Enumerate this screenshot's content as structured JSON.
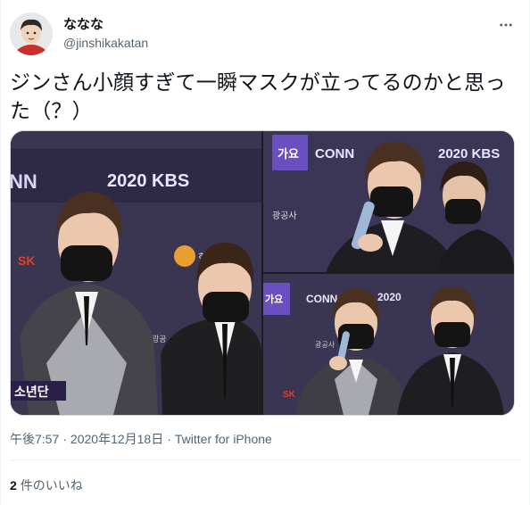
{
  "user": {
    "display_name": "ななな",
    "handle": "@jinshikakatan",
    "avatar_icon": "user-avatar"
  },
  "tweet": {
    "text": "ジンさん小顔すぎて一瞬マスクが立ってるのかと思った（？）"
  },
  "media": {
    "photos": [
      {
        "signs": [
          "2020 KBS",
          "SK",
          "한국",
          "광공",
          "소년단",
          "NN"
        ]
      },
      {
        "signs": [
          "CONN",
          "2020 KBS",
          "가요",
          "광공사"
        ]
      },
      {
        "signs": [
          "CONN",
          "2020",
          "가요",
          "광공사",
          "SK"
        ]
      }
    ]
  },
  "meta": {
    "time": "午後7:57",
    "separator": "·",
    "date": "2020年12月18日",
    "source": "Twitter for iPhone"
  },
  "stats": {
    "likes_count": "2",
    "likes_label": "件のいいね"
  },
  "icons": {
    "more": "more-dots-icon"
  },
  "colors": {
    "text": "#0f1419",
    "secondary": "#536471",
    "border": "#cfd9de",
    "backdrop": "#3a3550"
  }
}
